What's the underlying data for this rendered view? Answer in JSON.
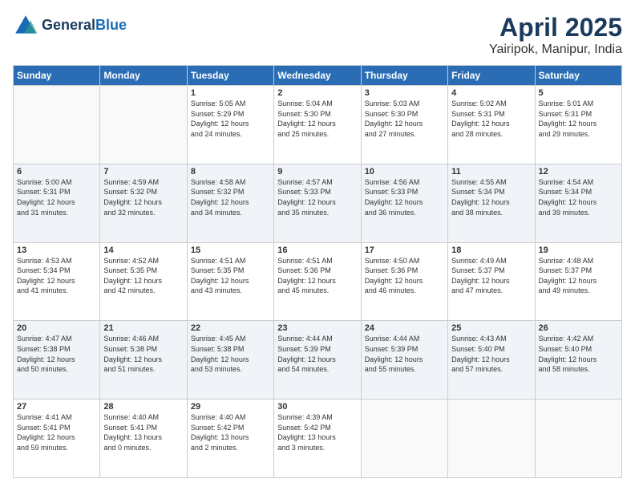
{
  "header": {
    "logo_line1": "General",
    "logo_line2": "Blue",
    "month": "April 2025",
    "location": "Yairipok, Manipur, India"
  },
  "weekdays": [
    "Sunday",
    "Monday",
    "Tuesday",
    "Wednesday",
    "Thursday",
    "Friday",
    "Saturday"
  ],
  "weeks": [
    [
      {
        "day": "",
        "info": ""
      },
      {
        "day": "",
        "info": ""
      },
      {
        "day": "1",
        "info": "Sunrise: 5:05 AM\nSunset: 5:29 PM\nDaylight: 12 hours\nand 24 minutes."
      },
      {
        "day": "2",
        "info": "Sunrise: 5:04 AM\nSunset: 5:30 PM\nDaylight: 12 hours\nand 25 minutes."
      },
      {
        "day": "3",
        "info": "Sunrise: 5:03 AM\nSunset: 5:30 PM\nDaylight: 12 hours\nand 27 minutes."
      },
      {
        "day": "4",
        "info": "Sunrise: 5:02 AM\nSunset: 5:31 PM\nDaylight: 12 hours\nand 28 minutes."
      },
      {
        "day": "5",
        "info": "Sunrise: 5:01 AM\nSunset: 5:31 PM\nDaylight: 12 hours\nand 29 minutes."
      }
    ],
    [
      {
        "day": "6",
        "info": "Sunrise: 5:00 AM\nSunset: 5:31 PM\nDaylight: 12 hours\nand 31 minutes."
      },
      {
        "day": "7",
        "info": "Sunrise: 4:59 AM\nSunset: 5:32 PM\nDaylight: 12 hours\nand 32 minutes."
      },
      {
        "day": "8",
        "info": "Sunrise: 4:58 AM\nSunset: 5:32 PM\nDaylight: 12 hours\nand 34 minutes."
      },
      {
        "day": "9",
        "info": "Sunrise: 4:57 AM\nSunset: 5:33 PM\nDaylight: 12 hours\nand 35 minutes."
      },
      {
        "day": "10",
        "info": "Sunrise: 4:56 AM\nSunset: 5:33 PM\nDaylight: 12 hours\nand 36 minutes."
      },
      {
        "day": "11",
        "info": "Sunrise: 4:55 AM\nSunset: 5:34 PM\nDaylight: 12 hours\nand 38 minutes."
      },
      {
        "day": "12",
        "info": "Sunrise: 4:54 AM\nSunset: 5:34 PM\nDaylight: 12 hours\nand 39 minutes."
      }
    ],
    [
      {
        "day": "13",
        "info": "Sunrise: 4:53 AM\nSunset: 5:34 PM\nDaylight: 12 hours\nand 41 minutes."
      },
      {
        "day": "14",
        "info": "Sunrise: 4:52 AM\nSunset: 5:35 PM\nDaylight: 12 hours\nand 42 minutes."
      },
      {
        "day": "15",
        "info": "Sunrise: 4:51 AM\nSunset: 5:35 PM\nDaylight: 12 hours\nand 43 minutes."
      },
      {
        "day": "16",
        "info": "Sunrise: 4:51 AM\nSunset: 5:36 PM\nDaylight: 12 hours\nand 45 minutes."
      },
      {
        "day": "17",
        "info": "Sunrise: 4:50 AM\nSunset: 5:36 PM\nDaylight: 12 hours\nand 46 minutes."
      },
      {
        "day": "18",
        "info": "Sunrise: 4:49 AM\nSunset: 5:37 PM\nDaylight: 12 hours\nand 47 minutes."
      },
      {
        "day": "19",
        "info": "Sunrise: 4:48 AM\nSunset: 5:37 PM\nDaylight: 12 hours\nand 49 minutes."
      }
    ],
    [
      {
        "day": "20",
        "info": "Sunrise: 4:47 AM\nSunset: 5:38 PM\nDaylight: 12 hours\nand 50 minutes."
      },
      {
        "day": "21",
        "info": "Sunrise: 4:46 AM\nSunset: 5:38 PM\nDaylight: 12 hours\nand 51 minutes."
      },
      {
        "day": "22",
        "info": "Sunrise: 4:45 AM\nSunset: 5:38 PM\nDaylight: 12 hours\nand 53 minutes."
      },
      {
        "day": "23",
        "info": "Sunrise: 4:44 AM\nSunset: 5:39 PM\nDaylight: 12 hours\nand 54 minutes."
      },
      {
        "day": "24",
        "info": "Sunrise: 4:44 AM\nSunset: 5:39 PM\nDaylight: 12 hours\nand 55 minutes."
      },
      {
        "day": "25",
        "info": "Sunrise: 4:43 AM\nSunset: 5:40 PM\nDaylight: 12 hours\nand 57 minutes."
      },
      {
        "day": "26",
        "info": "Sunrise: 4:42 AM\nSunset: 5:40 PM\nDaylight: 12 hours\nand 58 minutes."
      }
    ],
    [
      {
        "day": "27",
        "info": "Sunrise: 4:41 AM\nSunset: 5:41 PM\nDaylight: 12 hours\nand 59 minutes."
      },
      {
        "day": "28",
        "info": "Sunrise: 4:40 AM\nSunset: 5:41 PM\nDaylight: 13 hours\nand 0 minutes."
      },
      {
        "day": "29",
        "info": "Sunrise: 4:40 AM\nSunset: 5:42 PM\nDaylight: 13 hours\nand 2 minutes."
      },
      {
        "day": "30",
        "info": "Sunrise: 4:39 AM\nSunset: 5:42 PM\nDaylight: 13 hours\nand 3 minutes."
      },
      {
        "day": "",
        "info": ""
      },
      {
        "day": "",
        "info": ""
      },
      {
        "day": "",
        "info": ""
      }
    ]
  ]
}
